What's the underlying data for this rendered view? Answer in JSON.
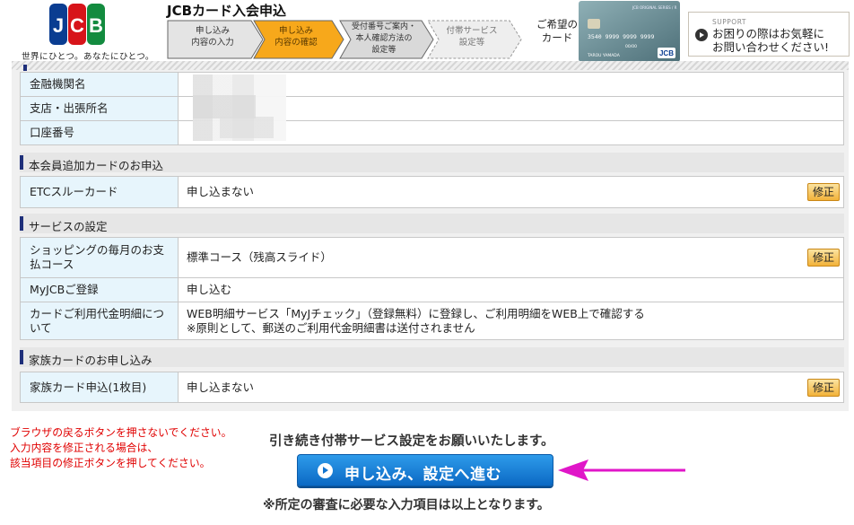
{
  "header": {
    "logo_text": "JCB",
    "tagline": "世界にひとつ。あなたにひとつ。",
    "title": "JCBカード入会申込",
    "steps": [
      {
        "label": "申し込み\n内容の入力",
        "state": "done"
      },
      {
        "label": "申し込み\n内容の確認",
        "state": "current"
      },
      {
        "label": "受付番号ご案内・\n本人確認方法の\n設定等",
        "state": "next"
      },
      {
        "label": "付帯サービス\n設定等",
        "state": "future"
      }
    ],
    "card_caption": "ご希望の\nカード",
    "card_image": {
      "brand_line": "JCB ORIGINAL SERIES / R",
      "number": "3540 9999 9999 9999",
      "expiry": "00/00",
      "holder": "TAROU YAMADA",
      "logo": "JCB"
    },
    "support": {
      "tag": "SUPPORT",
      "text": "お困りの際はお気軽に\nお問い合わせください!"
    }
  },
  "bank": {
    "rows": [
      {
        "label": "金融機関名"
      },
      {
        "label": "支店・出張所名"
      },
      {
        "label": "口座番号"
      }
    ]
  },
  "sections": {
    "additional_card": {
      "title": "本会員追加カードのお申込",
      "row": {
        "label": "ETCスルーカード",
        "value": "申し込まない",
        "edit": "修正"
      }
    },
    "services": {
      "title": "サービスの設定",
      "rows": [
        {
          "label": "ショッピングの毎月のお支払コース",
          "value": "標準コース（残高スライド）",
          "edit": "修正"
        },
        {
          "label": "MyJCBご登録",
          "value": "申し込む"
        },
        {
          "label": "カードご利用代金明細について",
          "value": "WEB明細サービス「MyJチェック」（登録無料）に登録し、ご利用明細をWEB上で確認する",
          "value_sub": "※原則として、郵送のご利用代金明細書は送付されません"
        }
      ]
    },
    "family_card": {
      "title": "家族カードのお申し込み",
      "row": {
        "label": "家族カード申込(1枚目)",
        "value": "申し込まない",
        "edit": "修正"
      }
    }
  },
  "footer": {
    "warning": "ブラウザの戻るボタンを押さないでください。\n入力内容を修正される場合は、\n該当項目の修正ボタンを押してください。",
    "continue_message": "引き続き付帯サービス設定をお願いいたします。",
    "proceed_button": "申し込み、設定へ進む",
    "note": "※所定の審査に必要な入力項目は以上となります。"
  },
  "colors": {
    "step_active": "#f7a81b",
    "step_inactive": "#d9d9d9",
    "label_bg": "#e7f5fc",
    "section_bar": "#1e2f7a",
    "warning": "#e00000",
    "button": "#1374cf",
    "arrow": "#e016c8",
    "edit_button": "#f2b23a"
  }
}
